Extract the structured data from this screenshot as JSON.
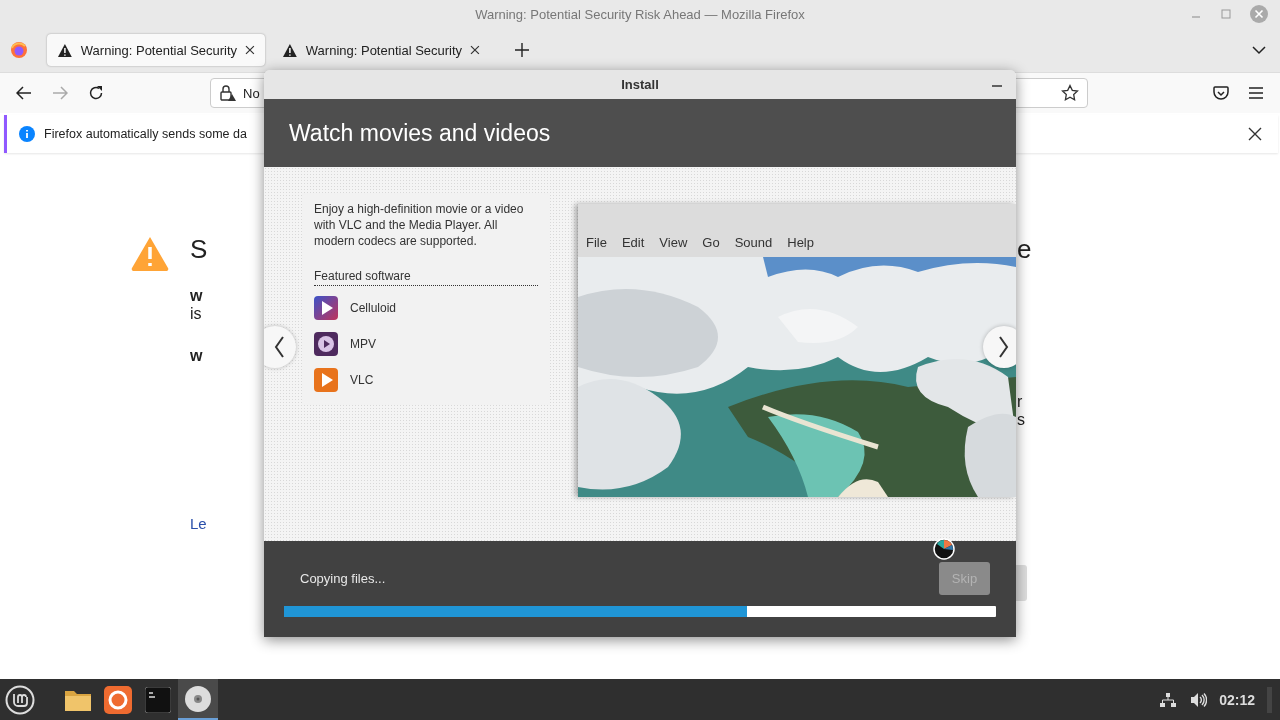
{
  "firefox": {
    "title": "Warning: Potential Security Risk Ahead — Mozilla Firefox",
    "tabs": [
      {
        "label": "Warning: Potential Security",
        "selected": true
      },
      {
        "label": "Warning: Potential Security",
        "selected": false
      }
    ],
    "url_text": "No",
    "notification": "Firefox automatically sends some da",
    "page_left": [
      "S",
      "w",
      "is",
      "w"
    ],
    "page_link": "Le",
    "page_right": [
      "e",
      "r",
      "s"
    ]
  },
  "installer": {
    "title": "Install",
    "heading": "Watch movies and videos",
    "description": "Enjoy a high-definition movie or a video with VLC and the Media Player. All modern codecs are supported.",
    "featured_heading": "Featured software",
    "apps": [
      {
        "name": "Celluloid",
        "kind": "celluloid"
      },
      {
        "name": "MPV",
        "kind": "mpv"
      },
      {
        "name": "VLC",
        "kind": "vlc"
      }
    ],
    "menu": [
      "File",
      "Edit",
      "View",
      "Go",
      "Sound",
      "Help"
    ],
    "status": "Copying files...",
    "skip": {
      "label": "Skip",
      "disabled": true
    },
    "progress": {
      "level": 0.65
    }
  },
  "taskbar": {
    "apps": [
      {
        "kind": "files",
        "selected": false
      },
      {
        "kind": "browser",
        "selected": false
      },
      {
        "kind": "terminal",
        "selected": false
      },
      {
        "kind": "disc",
        "selected": true
      }
    ],
    "clock": "02:12"
  }
}
